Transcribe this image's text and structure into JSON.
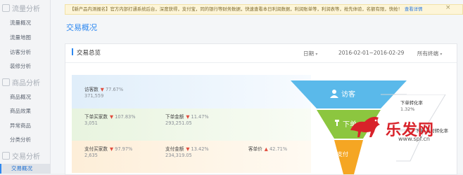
{
  "sidebar": {
    "sections": [
      {
        "title": "流量分析",
        "items": [
          "流量概况",
          "流量地图",
          "访客分析",
          "装修分析"
        ]
      },
      {
        "title": "商品分析",
        "items": [
          "商品概况",
          "商品效果",
          "异常商品",
          "分类分析"
        ]
      },
      {
        "title": "交易分析",
        "items": [
          "交易概况"
        ]
      }
    ],
    "active_item": "交易概况"
  },
  "notice": {
    "text": "【新产品内测报名】官方内部打通系统后台，深度获得，支付宝，同的银行等财务数据，快速查看本日利润数据，利润账单等，利润表等，抢先体验，名额有限，快抢！",
    "link": "查看详情",
    "close": "×"
  },
  "page_title": "交易概况",
  "card": {
    "title": "交易总览",
    "date_label": "日期",
    "date_range": "2016-02-01~2016-02-29",
    "terminal": "所有终端"
  },
  "metrics": {
    "visitors": {
      "label": "访客数",
      "change": "77.67%",
      "value": "371,559"
    },
    "order_buyers": {
      "label": "下单买家数",
      "change": "107.83%",
      "value": "3,051"
    },
    "order_amount": {
      "label": "下单金额",
      "change": "11.47%",
      "value": "293,251.05"
    },
    "pay_buyers": {
      "label": "支付买家数",
      "change": "97.97%",
      "value": "2,635"
    },
    "pay_amount": {
      "label": "支付金额",
      "change": "13.42%",
      "value": "234,319.05"
    },
    "unit_price": {
      "label": "客单价",
      "change": "42.71%",
      "value": ""
    }
  },
  "funnel": {
    "stages": [
      "访客",
      "下单",
      "支付"
    ],
    "colors": {
      "visitor": "#5ab9ea",
      "order": "#8cc63f",
      "pay": "#f5a623"
    }
  },
  "conversions": {
    "order_rate_label": "下单转化率",
    "order_rate_value": "1.32%",
    "pay_rate_label": "下单-支付转化率"
  },
  "watermark": {
    "text": "乐发网",
    "url": "www.spf.cn"
  }
}
